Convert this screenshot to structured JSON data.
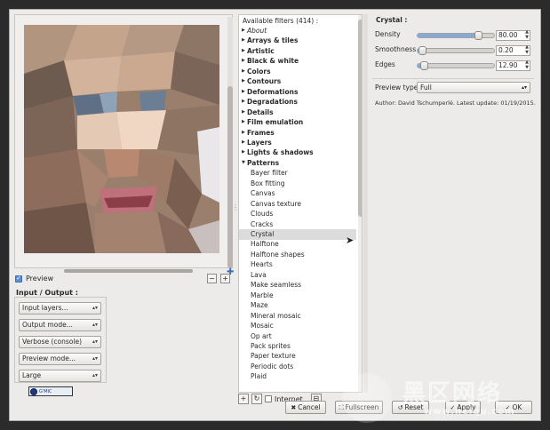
{
  "preview": {
    "checkbox_label": "Preview",
    "checked": true,
    "zoom_out": "−",
    "zoom_in": "+"
  },
  "io": {
    "title": "Input / Output :",
    "combos": [
      {
        "label": "Input layers..."
      },
      {
        "label": "Output mode..."
      },
      {
        "label": "Verbose (console)"
      },
      {
        "label": "Preview mode..."
      },
      {
        "label": "Large"
      }
    ]
  },
  "filters": {
    "header": "Available filters (414) :",
    "items": [
      {
        "label": "About",
        "style": "italic",
        "expand": true
      },
      {
        "label": "Arrays & tiles",
        "style": "bold",
        "expand": true
      },
      {
        "label": "Artistic",
        "style": "bold",
        "expand": true
      },
      {
        "label": "Black & white",
        "style": "bold",
        "expand": true
      },
      {
        "label": "Colors",
        "style": "bold",
        "expand": true
      },
      {
        "label": "Contours",
        "style": "bold",
        "expand": true
      },
      {
        "label": "Deformations",
        "style": "bold",
        "expand": true
      },
      {
        "label": "Degradations",
        "style": "bold",
        "expand": true
      },
      {
        "label": "Details",
        "style": "bold",
        "expand": true
      },
      {
        "label": "Film emulation",
        "style": "bold",
        "expand": true
      },
      {
        "label": "Frames",
        "style": "bold",
        "expand": true
      },
      {
        "label": "Layers",
        "style": "bold",
        "expand": true
      },
      {
        "label": "Lights & shadows",
        "style": "bold",
        "expand": true
      },
      {
        "label": "Patterns",
        "style": "bold",
        "expand": "open"
      },
      {
        "label": "Bayer filter",
        "style": "child"
      },
      {
        "label": "Box fitting",
        "style": "child"
      },
      {
        "label": "Canvas",
        "style": "child"
      },
      {
        "label": "Canvas texture",
        "style": "child"
      },
      {
        "label": "Clouds",
        "style": "child"
      },
      {
        "label": "Cracks",
        "style": "child"
      },
      {
        "label": "Crystal",
        "style": "child",
        "selected": true
      },
      {
        "label": "Halftone",
        "style": "child"
      },
      {
        "label": "Halftone shapes",
        "style": "child"
      },
      {
        "label": "Hearts",
        "style": "child"
      },
      {
        "label": "Lava",
        "style": "child"
      },
      {
        "label": "Make seamless",
        "style": "child"
      },
      {
        "label": "Marble",
        "style": "child"
      },
      {
        "label": "Maze",
        "style": "child"
      },
      {
        "label": "Mineral mosaic",
        "style": "child"
      },
      {
        "label": "Mosaic",
        "style": "child"
      },
      {
        "label": "Op art",
        "style": "child"
      },
      {
        "label": "Pack sprites",
        "style": "child"
      },
      {
        "label": "Paper texture",
        "style": "child"
      },
      {
        "label": "Periodic dots",
        "style": "child"
      },
      {
        "label": "Plaid",
        "style": "child"
      }
    ],
    "add_btn": "+",
    "refresh_btn": "↻",
    "internet_label": "Internet",
    "internet_checked": false,
    "collapse_btn": "⊟"
  },
  "params": {
    "filter_title": "Crystal :",
    "density": {
      "label": "Density",
      "value": "80.00",
      "level": 0.8
    },
    "smoothness": {
      "label": "Smoothness",
      "value": "0.20",
      "level": 0.07
    },
    "edges": {
      "label": "Edges",
      "value": "12.90",
      "level": 0.09
    },
    "preview_type_label": "Preview type",
    "preview_type_value": "Full",
    "author": "Author: David Tschumperlé.     Latest update: 01/19/2015."
  },
  "actions": {
    "cancel": "Cancel",
    "fullscreen": "Fullscreen",
    "reset": "Reset",
    "apply": "Apply",
    "ok": "OK"
  },
  "watermark": {
    "title": "黑区网络",
    "url": "www.heiqu.com"
  },
  "colors": {
    "accent": "#86aad4",
    "selected_row": "#dcdcdc",
    "window_bg": "#ecebe9"
  }
}
